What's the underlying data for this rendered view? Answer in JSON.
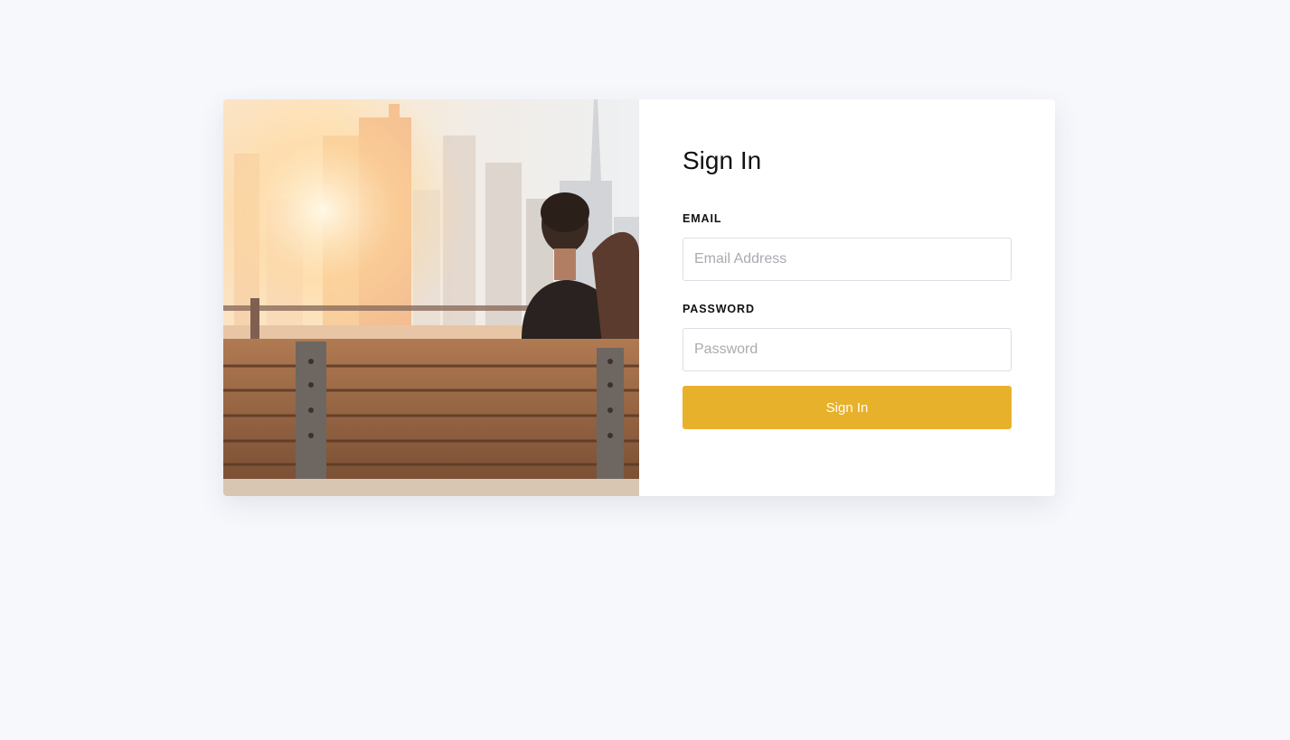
{
  "login": {
    "title": "Sign In",
    "email": {
      "label": "EMAIL",
      "placeholder": "Email Address",
      "value": ""
    },
    "password": {
      "label": "PASSWORD",
      "placeholder": "Password",
      "value": ""
    },
    "submit_label": "Sign In"
  },
  "colors": {
    "page_background": "#f7f8fc",
    "card_background": "#ffffff",
    "accent": "#e8b12b"
  }
}
